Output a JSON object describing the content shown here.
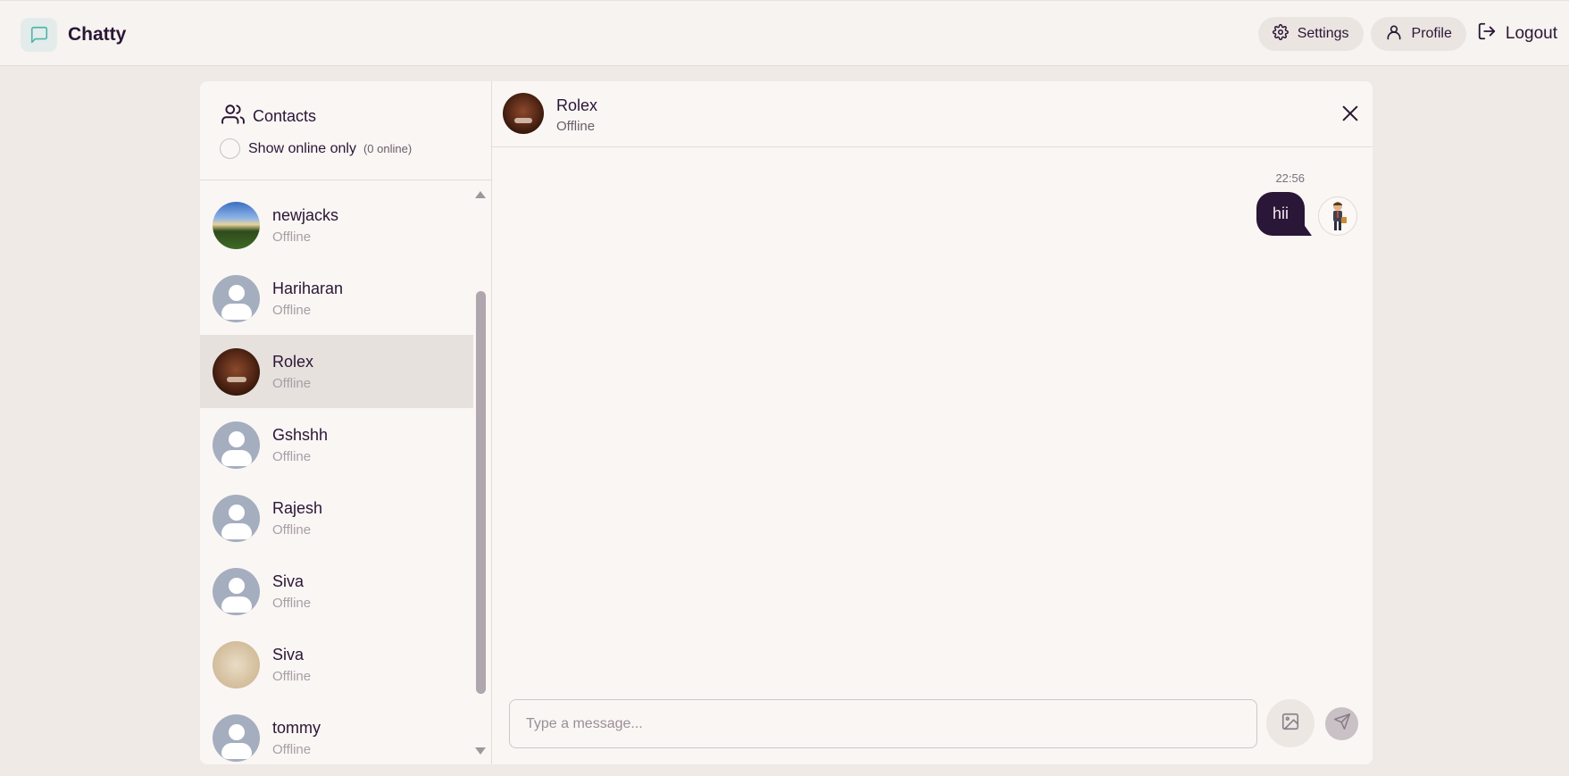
{
  "app": {
    "name": "Chatty"
  },
  "nav": {
    "settings_label": "Settings",
    "profile_label": "Profile",
    "logout_label": "Logout"
  },
  "sidebar": {
    "title": "Contacts",
    "online_filter_label": "Show online only",
    "online_count": "(0 online)",
    "contacts": [
      {
        "name": "newjacks",
        "status": "Offline",
        "avatar": "landscape-photo"
      },
      {
        "name": "Hariharan",
        "status": "Offline",
        "avatar": "placeholder-user-icon"
      },
      {
        "name": "Rolex",
        "status": "Offline",
        "avatar": "face-photo",
        "selected": true
      },
      {
        "name": "Gshshh",
        "status": "Offline",
        "avatar": "placeholder-user-icon"
      },
      {
        "name": "Rajesh",
        "status": "Offline",
        "avatar": "placeholder-user-icon"
      },
      {
        "name": "Siva",
        "status": "Offline",
        "avatar": "placeholder-user-icon"
      },
      {
        "name": "Siva",
        "status": "Offline",
        "avatar": "beige-photo"
      },
      {
        "name": "tommy",
        "status": "Offline",
        "avatar": "placeholder-user-icon"
      }
    ]
  },
  "chat": {
    "contact_name": "Rolex",
    "contact_status": "Offline",
    "messages": [
      {
        "time": "22:56",
        "text": "hii",
        "from": "me"
      }
    ],
    "input_placeholder": "Type a message..."
  },
  "colors": {
    "accent_dark": "#2a1636",
    "background": "#efeae6",
    "card": "#faf6f4",
    "selected_row": "#e7e1de"
  }
}
